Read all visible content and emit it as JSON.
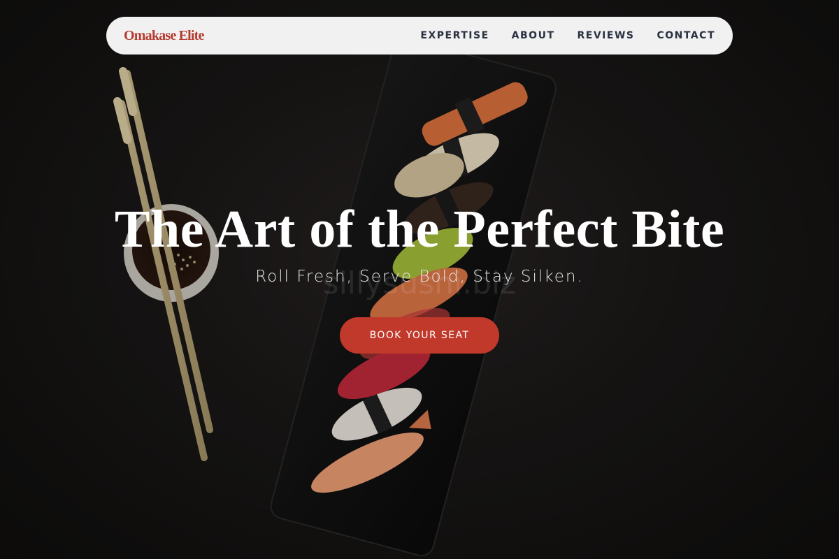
{
  "brand": {
    "name": "Omakase Elite",
    "color": "#b53a2f"
  },
  "nav": {
    "items": [
      {
        "label": "EXPERTISE"
      },
      {
        "label": "ABOUT"
      },
      {
        "label": "REVIEWS"
      },
      {
        "label": "CONTACT"
      }
    ]
  },
  "hero": {
    "title": "The Art of the Perfect Bite",
    "subtitle": "Roll Fresh, Serve Bold, Stay Silken.",
    "watermark": "sillysushi.biz",
    "cta_label": "BOOK YOUR SEAT",
    "cta_color": "#c0392b"
  },
  "colors": {
    "navbar_bg": "#f1f1f1",
    "nav_text": "#2a3140",
    "hero_bg": "#161413"
  }
}
